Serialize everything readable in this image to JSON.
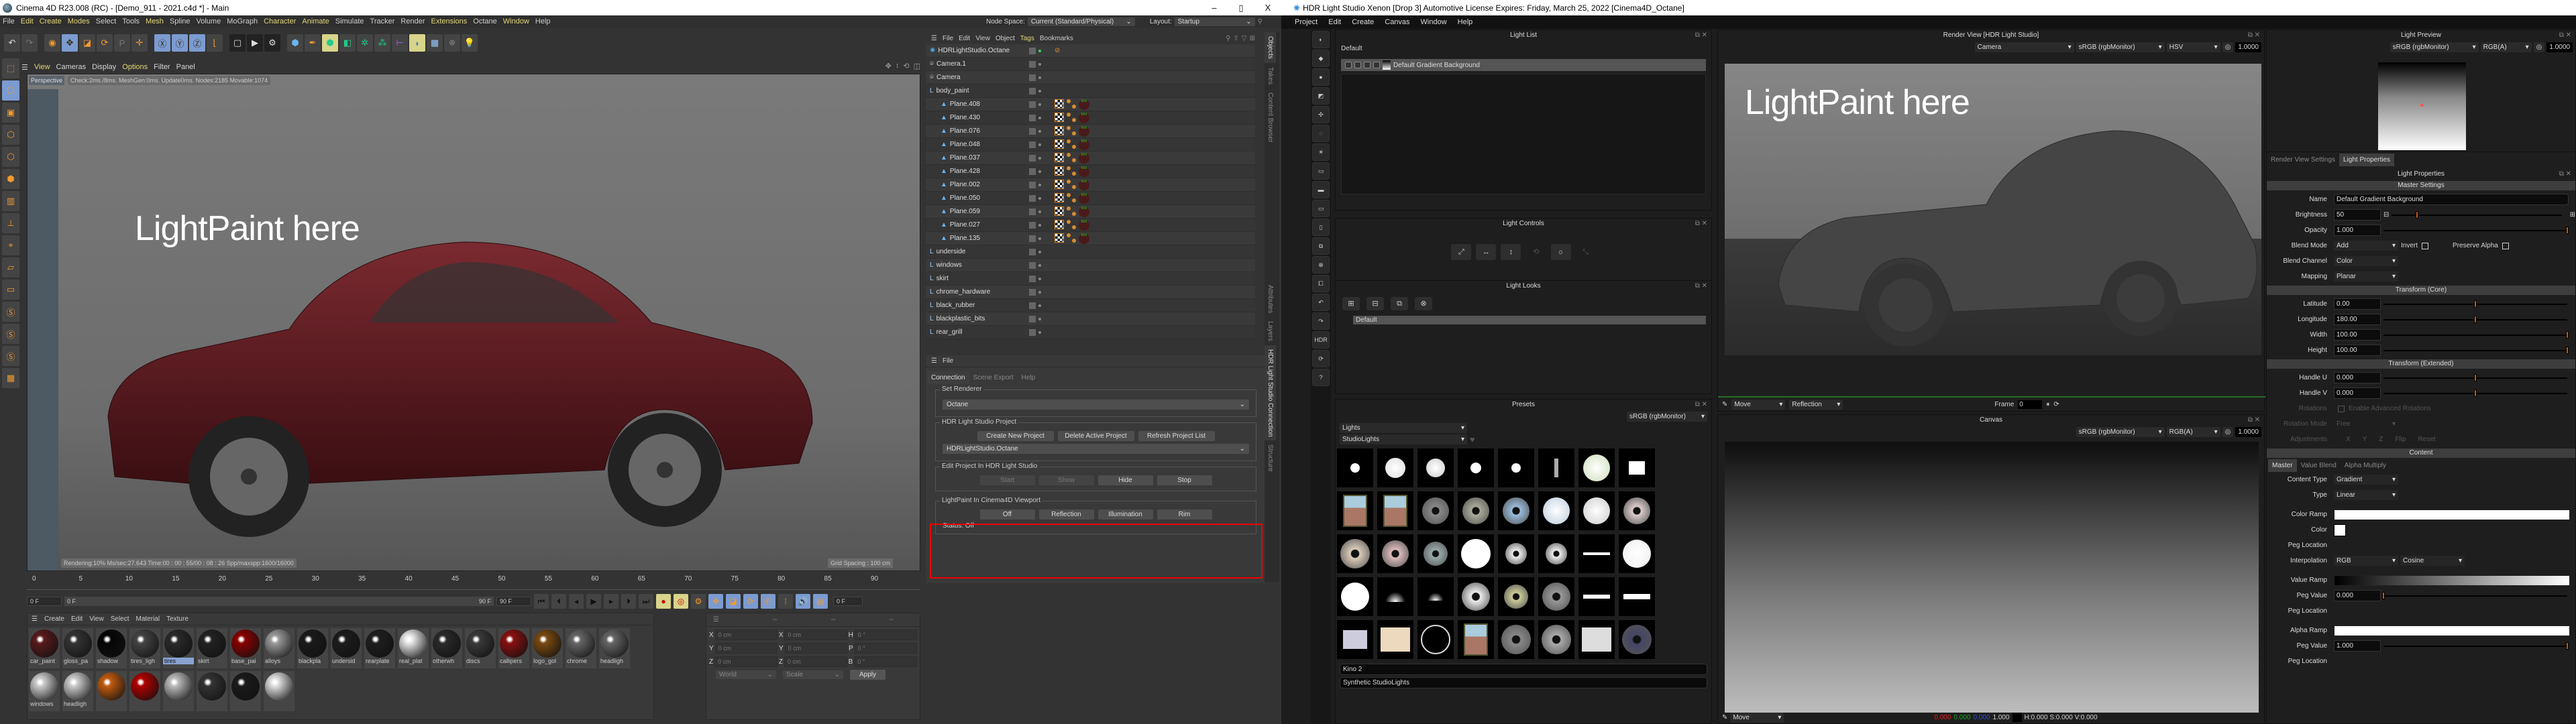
{
  "c4d": {
    "title": "Cinema 4D R23.008 (RC) - [Demo_911 - 2021.c4d *] - Main",
    "window_controls": {
      "minimize": "–",
      "maximize": "▯",
      "close": "X"
    },
    "menu": [
      "File",
      "Edit",
      "Create",
      "Modes",
      "Select",
      "Tools",
      "Mesh",
      "Spline",
      "Volume",
      "MoGraph",
      "Character",
      "Animate",
      "Simulate",
      "Tracker",
      "Render",
      "Extensions",
      "Octane",
      "Window",
      "Help"
    ],
    "node_space_label": "Node Space:",
    "node_space_value": "Current (Standard/Physical)",
    "layout_label": "Layout:",
    "layout_value": "Startup",
    "viewport_menu": [
      "View",
      "Cameras",
      "Display",
      "Options",
      "Filter",
      "Panel"
    ],
    "viewport": {
      "camera_label": "Perspective",
      "stats": "Check:2ms./8ms. MeshGen:0ms. Update0ms. Nodes:2185 Movable:1074",
      "overlay_text": "LightPaint here",
      "render_status": "Rendering:10% Ms/sec:27.643 Time:00 : 00 : 55/00 : 08 : 26 Spp/maxspp:1600/16000",
      "grid_spacing": "Grid Spacing : 100 cm"
    },
    "timeline": {
      "ticks": [
        "0",
        "5",
        "10",
        "15",
        "20",
        "25",
        "30",
        "35",
        "40",
        "45",
        "50",
        "55",
        "60",
        "65",
        "70",
        "75",
        "80",
        "85",
        "90"
      ],
      "current_frame": "0 F",
      "start_field": "0 F",
      "range_start": "0 F",
      "range_end": "90 F",
      "end_field": "90 F"
    },
    "material_menu": [
      "Create",
      "Edit",
      "View",
      "Select",
      "Material",
      "Texture"
    ],
    "materials": [
      {
        "name": "car_paint",
        "color": "#5a1a1c",
        "selected": false
      },
      {
        "name": "gloss_pa",
        "color": "#333333",
        "selected": false
      },
      {
        "name": "shadow",
        "color": "#050505",
        "selected": false
      },
      {
        "name": "tires_ligh",
        "color": "#444444",
        "selected": false
      },
      {
        "name": "tires",
        "color": "#2a2a2a",
        "selected": true
      },
      {
        "name": "skirt",
        "color": "#222222",
        "selected": false
      },
      {
        "name": "base_pai",
        "color": "#8a0000",
        "selected": false
      },
      {
        "name": "alloys",
        "color": "#9a9a9a",
        "selected": false
      },
      {
        "name": "blackpla",
        "color": "#1a1a1a",
        "selected": false
      },
      {
        "name": "undersid",
        "color": "#1c1c1c",
        "selected": false
      },
      {
        "name": "rearplate",
        "color": "#1e1e1e",
        "selected": false
      },
      {
        "name": "real_plat",
        "color": "#e8e8e8",
        "selected": false
      },
      {
        "name": "otherwh",
        "color": "#2a2a2a",
        "selected": false
      },
      {
        "name": "discs",
        "color": "#3a3a3a",
        "selected": false
      },
      {
        "name": "callipers",
        "color": "#8a1010",
        "selected": false
      },
      {
        "name": "logo_gol",
        "color": "#7a4a10",
        "selected": false
      },
      {
        "name": "chrome",
        "color": "#666666",
        "selected": false
      },
      {
        "name": "headligh",
        "color": "#666666",
        "selected": false
      },
      {
        "name": "windows",
        "color": "#cccccc",
        "selected": false
      },
      {
        "name": "headligh",
        "color": "#cccccc",
        "selected": false
      },
      {
        "name": "",
        "color": "#c05a10",
        "selected": false
      },
      {
        "name": "",
        "color": "#b00000",
        "selected": false
      },
      {
        "name": "",
        "color": "#bbbbbb",
        "selected": false
      },
      {
        "name": "",
        "color": "#333333",
        "selected": false
      },
      {
        "name": "",
        "color": "#1a1a1a",
        "selected": false
      },
      {
        "name": "",
        "color": "#e0e0e0",
        "selected": false
      }
    ],
    "coords": {
      "headers": [
        "--",
        "--",
        "--"
      ],
      "rows": [
        {
          "a_label": "X",
          "a": "0 cm",
          "b_label": "X",
          "b": "0 cm",
          "c_label": "H",
          "c": "0 °"
        },
        {
          "a_label": "Y",
          "a": "0 cm",
          "b_label": "Y",
          "b": "0 cm",
          "c_label": "P",
          "c": "0 °"
        },
        {
          "a_label": "Z",
          "a": "0 cm",
          "b_label": "Z",
          "b": "0 cm",
          "c_label": "B",
          "c": "0 °"
        }
      ],
      "space": "World",
      "mode": "Scale",
      "apply": "Apply"
    },
    "objects_menu": [
      "File",
      "Edit",
      "View",
      "Object",
      "Tags",
      "Bookmarks"
    ],
    "objects": [
      {
        "name": "HDRLightStudio.Octane",
        "icon": "hdr-icon",
        "indent": 0,
        "tags": "octane"
      },
      {
        "name": "Camera.1",
        "icon": "camera-icon",
        "indent": 0,
        "tags": ""
      },
      {
        "name": "Camera",
        "icon": "camera-icon",
        "indent": 0,
        "tags": ""
      },
      {
        "name": "body_paint",
        "icon": "null-icon",
        "indent": 0,
        "tags": ""
      },
      {
        "name": "Plane.408",
        "icon": "polygon-icon",
        "indent": 1,
        "tags": "mat"
      },
      {
        "name": "Plane.430",
        "icon": "polygon-icon",
        "indent": 1,
        "tags": "mat"
      },
      {
        "name": "Plane.076",
        "icon": "polygon-icon",
        "indent": 1,
        "tags": "mat"
      },
      {
        "name": "Plane.048",
        "icon": "polygon-icon",
        "indent": 1,
        "tags": "mat"
      },
      {
        "name": "Plane.037",
        "icon": "polygon-icon",
        "indent": 1,
        "tags": "mat"
      },
      {
        "name": "Plane.428",
        "icon": "polygon-icon",
        "indent": 1,
        "tags": "mat"
      },
      {
        "name": "Plane.002",
        "icon": "polygon-icon",
        "indent": 1,
        "tags": "mat"
      },
      {
        "name": "Plane.050",
        "icon": "polygon-icon",
        "indent": 1,
        "tags": "mat"
      },
      {
        "name": "Plane.059",
        "icon": "polygon-icon",
        "indent": 1,
        "tags": "mat"
      },
      {
        "name": "Plane.027",
        "icon": "polygon-icon",
        "indent": 1,
        "tags": "mat"
      },
      {
        "name": "Plane.135",
        "icon": "polygon-icon",
        "indent": 1,
        "tags": "mat"
      },
      {
        "name": "underside",
        "icon": "null-icon",
        "indent": 0,
        "tags": ""
      },
      {
        "name": "windows",
        "icon": "null-icon",
        "indent": 0,
        "tags": ""
      },
      {
        "name": "skirt",
        "icon": "null-icon",
        "indent": 0,
        "tags": ""
      },
      {
        "name": "chrome_hardware",
        "icon": "null-icon",
        "indent": 0,
        "tags": ""
      },
      {
        "name": "black_rubber",
        "icon": "null-icon",
        "indent": 0,
        "tags": ""
      },
      {
        "name": "blackplastic_bits",
        "icon": "null-icon",
        "indent": 0,
        "tags": ""
      },
      {
        "name": "rear_grill",
        "icon": "null-icon",
        "indent": 0,
        "tags": ""
      }
    ],
    "side_tabs_top": [
      "Objects",
      "Takes",
      "Content Browser"
    ],
    "side_tabs_bottom": [
      "Attributes",
      "Layers",
      "HDR Light Studio Connection",
      "Structure"
    ],
    "connection": {
      "menu_file": "File",
      "tabs": [
        "Connection",
        "Scene Export",
        "Help"
      ],
      "set_renderer_label": "Set Renderer",
      "renderer_value": "Octane",
      "project_label": "HDR Light Studio Project",
      "create_project": "Create New Project",
      "delete_project": "Delete Active Project",
      "refresh_list": "Refresh Project List",
      "project_value": "HDRLightStudio.Octane",
      "edit_label": "Edit Project In HDR Light Studio",
      "start": "Start",
      "show": "Show",
      "hide": "Hide",
      "stop": "Stop",
      "lightpaint_label": "LightPaint In Cinema4D Viewport",
      "lp_off": "Off",
      "lp_reflection": "Reflection",
      "lp_illumination": "Illumination",
      "lp_rim": "Rim",
      "status": "Status: Off"
    }
  },
  "hls": {
    "title": "HDR Light Studio Xenon [Drop 3] Automotive License Expires: Friday, March 25, 2022  [Cinema4D_Octane]",
    "menu": [
      "Project",
      "Edit",
      "Create",
      "Canvas",
      "Window",
      "Help"
    ],
    "light_list": {
      "title": "Light List",
      "group": "Default",
      "lights": [
        {
          "name": "Default Gradient Background"
        }
      ]
    },
    "light_controls": {
      "title": "Light Controls"
    },
    "light_looks": {
      "title": "Light Looks",
      "looks": [
        "Default"
      ]
    },
    "presets": {
      "title": "Presets",
      "colorspace": "sRGB (rgbMonitor)",
      "category": "Lights",
      "subcategory": "StudioLights",
      "selected_name": "Kino 2",
      "collection": "Synthetic StudioLights"
    },
    "render_view": {
      "title": "Render View [HDR Light Studio]",
      "camera": "Camera",
      "colorspace": "sRGB (rgbMonitor)",
      "mode": "HSV",
      "exposure": "1.0000",
      "overlay_text": "LightPaint here",
      "tool": "Move",
      "paint_mode": "Reflection",
      "frame_label": "Frame",
      "frame_value": "0"
    },
    "canvas": {
      "title": "Canvas",
      "colorspace": "sRGB (rgbMonitor)",
      "channel": "RGB(A)",
      "exposure": "1.0000",
      "tool": "Move",
      "readout_r": "0.000",
      "readout_g": "0.000",
      "readout_b": "0.000",
      "readout_a": "1.000",
      "readout_hsv": "H:0.000 S:0.000 V:0.000",
      "readout_colors": {
        "r": "#e02020",
        "g": "#20a020",
        "b": "#3050e0"
      }
    },
    "light_preview": {
      "title": "Light Preview",
      "colorspace": "sRGB (rgbMonitor)",
      "channel": "RGB(A)",
      "exposure": "1.0000"
    },
    "properties": {
      "tabs": [
        "Render View Settings",
        "Light Properties"
      ],
      "title": "Light Properties",
      "master_header": "Master Settings",
      "name_label": "Name",
      "name_value": "Default Gradient Background",
      "brightness_label": "Brightness",
      "brightness_value": "50",
      "brightness_fraction": 0.15,
      "opacity_label": "Opacity",
      "opacity_value": "1.000",
      "opacity_fraction": 1.0,
      "blend_mode_label": "Blend Mode",
      "blend_mode_value": "Add",
      "invert_label": "Invert",
      "preserve_alpha_label": "Preserve Alpha",
      "blend_channel_label": "Blend Channel",
      "blend_channel_value": "Color",
      "mapping_label": "Mapping",
      "mapping_value": "Planar",
      "transform_core_header": "Transform (Core)",
      "latitude_label": "Latitude",
      "latitude_value": "0.00",
      "latitude_fraction": 0.5,
      "longitude_label": "Longitude",
      "longitude_value": "180.00",
      "longitude_fraction": 0.5,
      "width_label": "Width",
      "width_value": "100.00",
      "width_fraction": 1.0,
      "height_label": "Height",
      "height_value": "100.00",
      "height_fraction": 1.0,
      "transform_ext_header": "Transform (Extended)",
      "handle_u_label": "Handle U",
      "handle_u_value": "0.000",
      "handle_u_fraction": 0.5,
      "handle_v_label": "Handle V",
      "handle_v_value": "0.000",
      "handle_v_fraction": 0.5,
      "rotations_label": "Rotations",
      "rotations_check": "Enable Advanced Rotations",
      "rotation_mode_label": "Rotation Mode",
      "rotation_mode_value": "Free",
      "adjustments_label": "Adjustments",
      "adj_x": "X",
      "adj_y": "Y",
      "adj_z": "Z",
      "flip": "Flip",
      "reset": "Reset",
      "content_header": "Content",
      "content_tabs": [
        "Master",
        "Value Blend",
        "Alpha Multiply"
      ],
      "content_type_label": "Content Type",
      "content_type_value": "Gradient",
      "type_label": "Type",
      "type_value": "Linear",
      "color_ramp_label": "Color Ramp",
      "color_label": "Color",
      "peg_location_label": "Peg Location",
      "interpolation_label": "Interpolation",
      "interpolation_value": "RGB",
      "interpolation_curve": "Cosine",
      "value_ramp_label": "Value Ramp",
      "peg_value_label": "Peg Value",
      "value_peg_value": "0.000",
      "value_peg_fraction": 0.0,
      "alpha_ramp_label": "Alpha Ramp",
      "alpha_peg_value": "1.000",
      "alpha_peg_fraction": 1.0
    },
    "accent_color": "#c55a10"
  }
}
